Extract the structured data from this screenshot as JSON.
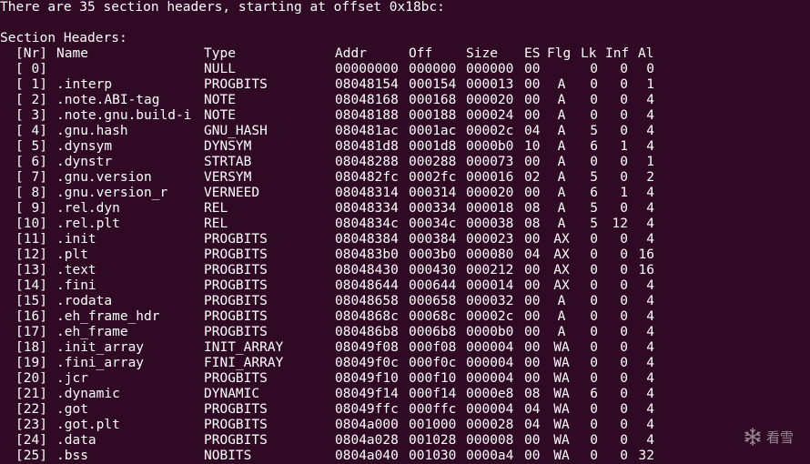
{
  "intro_line": "There are 35 section headers, starting at offset 0x18bc:",
  "section_title": "Section Headers:",
  "header": {
    "nr": "[Nr]",
    "name": "Name",
    "type": "Type",
    "addr": "Addr",
    "off": "Off",
    "size": "Size",
    "es": "ES",
    "flg": "Flg",
    "lk": "Lk",
    "inf": "Inf",
    "al": "Al"
  },
  "rows": [
    {
      "nr": "[ 0]",
      "name": "",
      "type": "NULL",
      "addr": "00000000",
      "off": "000000",
      "size": "000000",
      "es": "00",
      "flg": "",
      "lk": "0",
      "inf": "0",
      "al": "0"
    },
    {
      "nr": "[ 1]",
      "name": ".interp",
      "type": "PROGBITS",
      "addr": "08048154",
      "off": "000154",
      "size": "000013",
      "es": "00",
      "flg": "A",
      "lk": "0",
      "inf": "0",
      "al": "1"
    },
    {
      "nr": "[ 2]",
      "name": ".note.ABI-tag",
      "type": "NOTE",
      "addr": "08048168",
      "off": "000168",
      "size": "000020",
      "es": "00",
      "flg": "A",
      "lk": "0",
      "inf": "0",
      "al": "4"
    },
    {
      "nr": "[ 3]",
      "name": ".note.gnu.build-i",
      "type": "NOTE",
      "addr": "08048188",
      "off": "000188",
      "size": "000024",
      "es": "00",
      "flg": "A",
      "lk": "0",
      "inf": "0",
      "al": "4"
    },
    {
      "nr": "[ 4]",
      "name": ".gnu.hash",
      "type": "GNU_HASH",
      "addr": "080481ac",
      "off": "0001ac",
      "size": "00002c",
      "es": "04",
      "flg": "A",
      "lk": "5",
      "inf": "0",
      "al": "4"
    },
    {
      "nr": "[ 5]",
      "name": ".dynsym",
      "type": "DYNSYM",
      "addr": "080481d8",
      "off": "0001d8",
      "size": "0000b0",
      "es": "10",
      "flg": "A",
      "lk": "6",
      "inf": "1",
      "al": "4"
    },
    {
      "nr": "[ 6]",
      "name": ".dynstr",
      "type": "STRTAB",
      "addr": "08048288",
      "off": "000288",
      "size": "000073",
      "es": "00",
      "flg": "A",
      "lk": "0",
      "inf": "0",
      "al": "1"
    },
    {
      "nr": "[ 7]",
      "name": ".gnu.version",
      "type": "VERSYM",
      "addr": "080482fc",
      "off": "0002fc",
      "size": "000016",
      "es": "02",
      "flg": "A",
      "lk": "5",
      "inf": "0",
      "al": "2"
    },
    {
      "nr": "[ 8]",
      "name": ".gnu.version_r",
      "type": "VERNEED",
      "addr": "08048314",
      "off": "000314",
      "size": "000020",
      "es": "00",
      "flg": "A",
      "lk": "6",
      "inf": "1",
      "al": "4"
    },
    {
      "nr": "[ 9]",
      "name": ".rel.dyn",
      "type": "REL",
      "addr": "08048334",
      "off": "000334",
      "size": "000018",
      "es": "08",
      "flg": "A",
      "lk": "5",
      "inf": "0",
      "al": "4"
    },
    {
      "nr": "[10]",
      "name": ".rel.plt",
      "type": "REL",
      "addr": "0804834c",
      "off": "00034c",
      "size": "000038",
      "es": "08",
      "flg": "A",
      "lk": "5",
      "inf": "12",
      "al": "4"
    },
    {
      "nr": "[11]",
      "name": ".init",
      "type": "PROGBITS",
      "addr": "08048384",
      "off": "000384",
      "size": "000023",
      "es": "00",
      "flg": "AX",
      "lk": "0",
      "inf": "0",
      "al": "4"
    },
    {
      "nr": "[12]",
      "name": ".plt",
      "type": "PROGBITS",
      "addr": "080483b0",
      "off": "0003b0",
      "size": "000080",
      "es": "04",
      "flg": "AX",
      "lk": "0",
      "inf": "0",
      "al": "16"
    },
    {
      "nr": "[13]",
      "name": ".text",
      "type": "PROGBITS",
      "addr": "08048430",
      "off": "000430",
      "size": "000212",
      "es": "00",
      "flg": "AX",
      "lk": "0",
      "inf": "0",
      "al": "16"
    },
    {
      "nr": "[14]",
      "name": ".fini",
      "type": "PROGBITS",
      "addr": "08048644",
      "off": "000644",
      "size": "000014",
      "es": "00",
      "flg": "AX",
      "lk": "0",
      "inf": "0",
      "al": "4"
    },
    {
      "nr": "[15]",
      "name": ".rodata",
      "type": "PROGBITS",
      "addr": "08048658",
      "off": "000658",
      "size": "000032",
      "es": "00",
      "flg": "A",
      "lk": "0",
      "inf": "0",
      "al": "4"
    },
    {
      "nr": "[16]",
      "name": ".eh_frame_hdr",
      "type": "PROGBITS",
      "addr": "0804868c",
      "off": "00068c",
      "size": "00002c",
      "es": "00",
      "flg": "A",
      "lk": "0",
      "inf": "0",
      "al": "4"
    },
    {
      "nr": "[17]",
      "name": ".eh_frame",
      "type": "PROGBITS",
      "addr": "080486b8",
      "off": "0006b8",
      "size": "0000b0",
      "es": "00",
      "flg": "A",
      "lk": "0",
      "inf": "0",
      "al": "4"
    },
    {
      "nr": "[18]",
      "name": ".init_array",
      "type": "INIT_ARRAY",
      "addr": "08049f08",
      "off": "000f08",
      "size": "000004",
      "es": "00",
      "flg": "WA",
      "lk": "0",
      "inf": "0",
      "al": "4"
    },
    {
      "nr": "[19]",
      "name": ".fini_array",
      "type": "FINI_ARRAY",
      "addr": "08049f0c",
      "off": "000f0c",
      "size": "000004",
      "es": "00",
      "flg": "WA",
      "lk": "0",
      "inf": "0",
      "al": "4"
    },
    {
      "nr": "[20]",
      "name": ".jcr",
      "type": "PROGBITS",
      "addr": "08049f10",
      "off": "000f10",
      "size": "000004",
      "es": "00",
      "flg": "WA",
      "lk": "0",
      "inf": "0",
      "al": "4"
    },
    {
      "nr": "[21]",
      "name": ".dynamic",
      "type": "DYNAMIC",
      "addr": "08049f14",
      "off": "000f14",
      "size": "0000e8",
      "es": "08",
      "flg": "WA",
      "lk": "6",
      "inf": "0",
      "al": "4"
    },
    {
      "nr": "[22]",
      "name": ".got",
      "type": "PROGBITS",
      "addr": "08049ffc",
      "off": "000ffc",
      "size": "000004",
      "es": "04",
      "flg": "WA",
      "lk": "0",
      "inf": "0",
      "al": "4"
    },
    {
      "nr": "[23]",
      "name": ".got.plt",
      "type": "PROGBITS",
      "addr": "0804a000",
      "off": "001000",
      "size": "000028",
      "es": "04",
      "flg": "WA",
      "lk": "0",
      "inf": "0",
      "al": "4"
    },
    {
      "nr": "[24]",
      "name": ".data",
      "type": "PROGBITS",
      "addr": "0804a028",
      "off": "001028",
      "size": "000008",
      "es": "00",
      "flg": "WA",
      "lk": "0",
      "inf": "0",
      "al": "4"
    },
    {
      "nr": "[25]",
      "name": ".bss",
      "type": "NOBITS",
      "addr": "0804a040",
      "off": "001030",
      "size": "0000a4",
      "es": "00",
      "flg": "WA",
      "lk": "0",
      "inf": "0",
      "al": "32"
    }
  ],
  "watermark": {
    "text": "看雪",
    "icon": "snowflake-icon"
  },
  "colors": {
    "background": "#300a24",
    "text": "#ffffff"
  }
}
